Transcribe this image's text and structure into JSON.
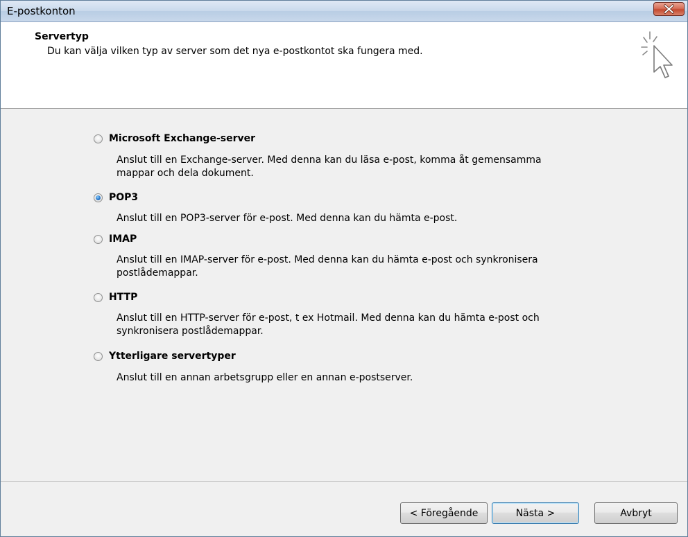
{
  "window": {
    "title": "E-postkonton"
  },
  "header": {
    "title": "Servertyp",
    "description": "Du kan välja vilken typ av server som det nya e-postkontot ska fungera med.",
    "icon": "new-account-cursor-icon"
  },
  "options": [
    {
      "label": "Microsoft Exchange-server",
      "description": "Anslut till en Exchange-server. Med denna kan du läsa e-post, komma åt gemensamma mappar och dela dokument.",
      "checked": false
    },
    {
      "label": "POP3",
      "description": "Anslut till en POP3-server för e-post. Med denna kan du hämta e-post.",
      "checked": true
    },
    {
      "label": "IMAP",
      "description": "Anslut till en IMAP-server för e-post. Med denna kan du hämta e-post och synkronisera postlådemappar.",
      "checked": false
    },
    {
      "label": "HTTP",
      "description": "Anslut till en HTTP-server för e-post, t ex Hotmail. Med denna kan du hämta e-post och synkronisera postlådemappar.",
      "checked": false
    },
    {
      "label": "Ytterligare servertyper",
      "description": "Anslut till en annan arbetsgrupp eller en annan e-postserver.",
      "checked": false
    }
  ],
  "buttons": {
    "back": "< Föregående",
    "next": "Nästa >",
    "cancel": "Avbryt"
  },
  "colors": {
    "close_button": "#c44a30",
    "titlebar": "#c9d9ec",
    "radio_selected": "#2a77c9"
  }
}
